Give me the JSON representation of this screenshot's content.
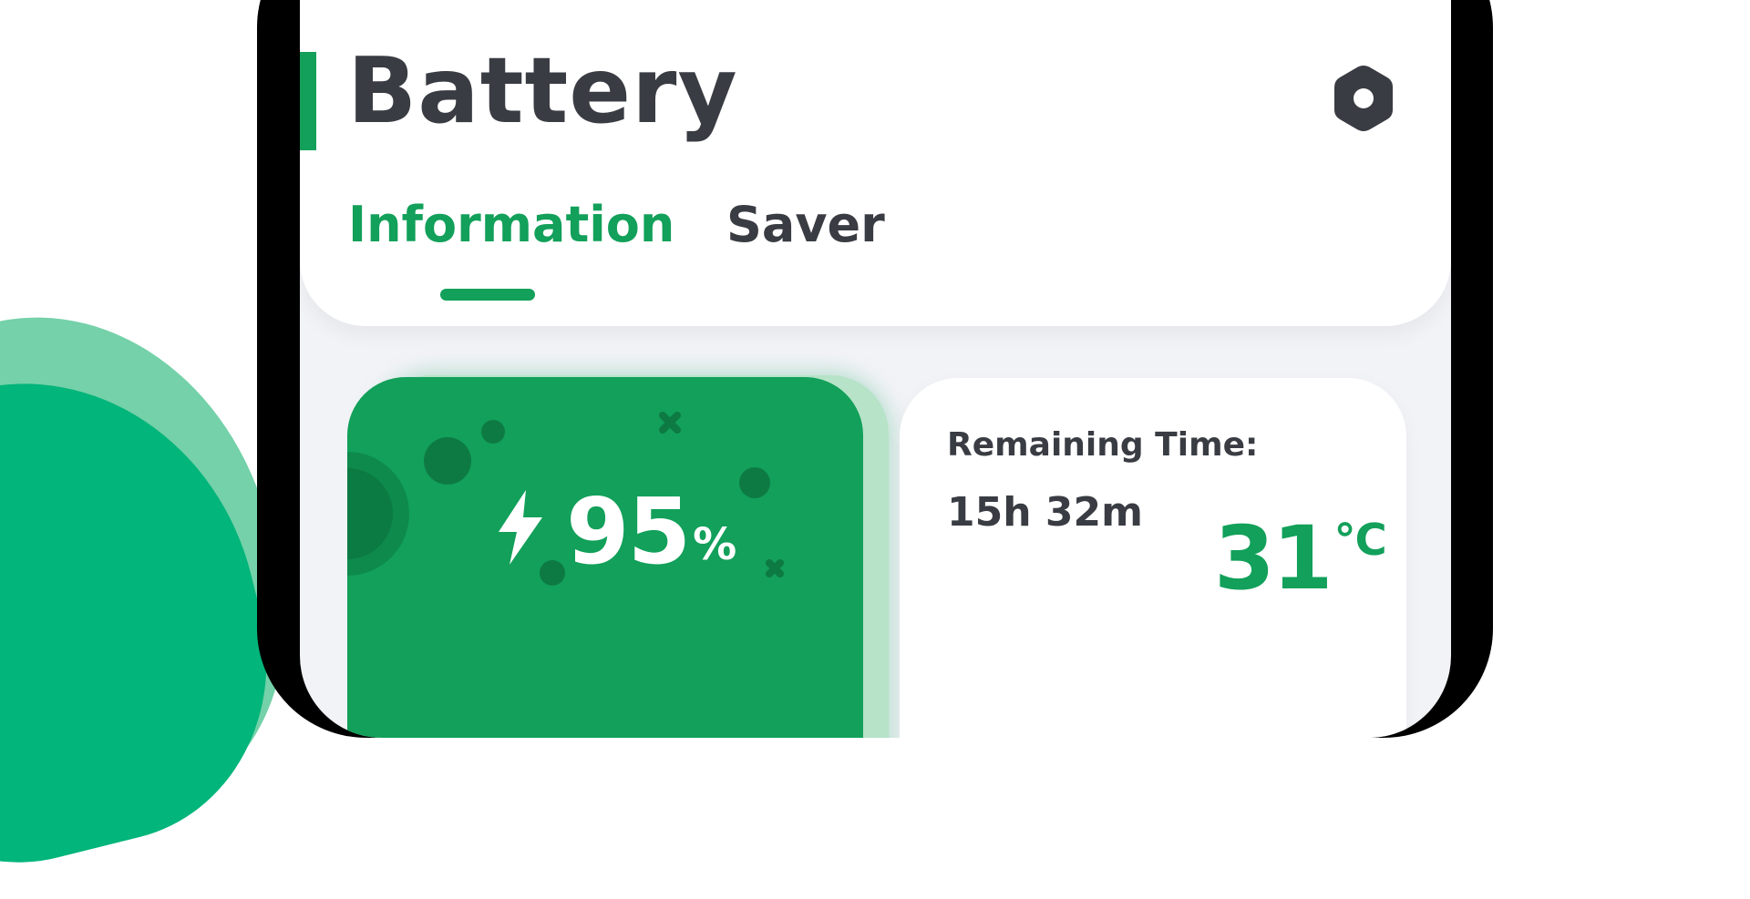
{
  "header": {
    "title": "Battery",
    "settings_icon": "settings-icon"
  },
  "tabs": [
    {
      "label": "Information",
      "active": true
    },
    {
      "label": "Saver",
      "active": false
    }
  ],
  "battery_level": {
    "value": "95",
    "unit": "%",
    "icon": "lightning-bolt-icon"
  },
  "info": {
    "remaining_label": "Remaining Time:",
    "remaining_value": "15h 32m",
    "temperature_value": "31",
    "temperature_unit": "℃"
  },
  "colors": {
    "accent": "#12a05a",
    "text_dark": "#3a3c43",
    "screen_bg": "#f2f3f7",
    "blob_light": "#74d1a9",
    "blob_dark": "#02b57a"
  }
}
